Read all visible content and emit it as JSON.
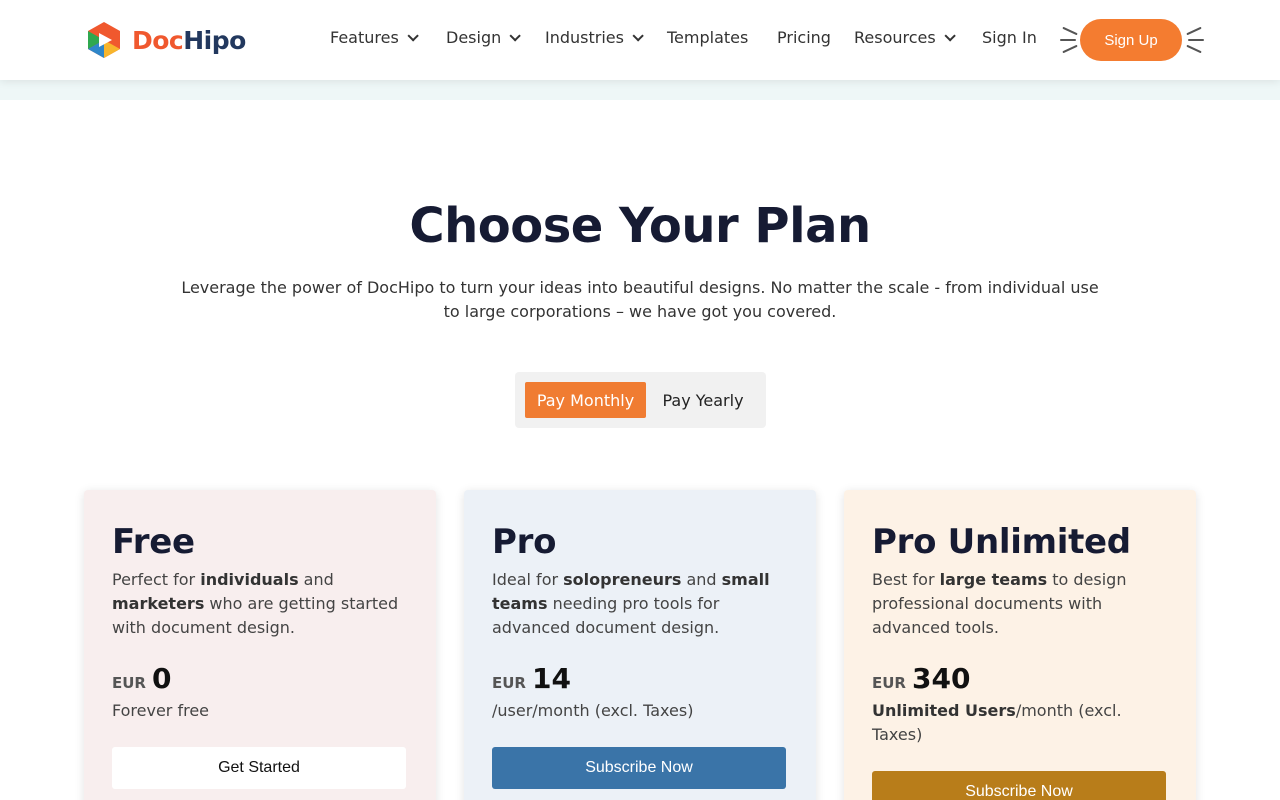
{
  "brand": {
    "name_part1": "Doc",
    "name_part2": "Hipo",
    "logo_icon": "dochipo-play-icon"
  },
  "nav": {
    "items": [
      {
        "label": "Features",
        "has_dropdown": true
      },
      {
        "label": "Design",
        "has_dropdown": true
      },
      {
        "label": "Industries",
        "has_dropdown": true
      },
      {
        "label": "Templates",
        "has_dropdown": false
      },
      {
        "label": "Pricing",
        "has_dropdown": false
      },
      {
        "label": "Resources",
        "has_dropdown": true
      },
      {
        "label": "Sign In",
        "has_dropdown": false
      }
    ],
    "signup_label": "Sign Up"
  },
  "hero": {
    "title": "Choose Your Plan",
    "subtitle": "Leverage the power of DocHipo to turn your ideas into beautiful designs. No matter the scale - from individual use to large corporations – we have got you covered."
  },
  "billing_toggle": {
    "monthly_label": "Pay Monthly",
    "yearly_label": "Pay Yearly",
    "selected": "monthly"
  },
  "plans": [
    {
      "name": "Free",
      "desc_parts": [
        "Perfect for ",
        "individuals",
        " and ",
        "marketers",
        " who are getting started with document design."
      ],
      "currency": "EUR",
      "amount": "0",
      "note_bold": "",
      "note": "Forever free",
      "cta": "Get Started"
    },
    {
      "name": "Pro",
      "desc_parts": [
        "Ideal for ",
        "solopreneurs",
        " and ",
        "small teams",
        " needing pro tools for advanced document design."
      ],
      "currency": "EUR",
      "amount": "14",
      "note_bold": "",
      "note": "/user/month (excl. Taxes)",
      "cta": "Subscribe Now"
    },
    {
      "name": "Pro Unlimited",
      "desc_parts": [
        "Best for ",
        "large teams",
        " to design professional documents with advanced tools.",
        "",
        ""
      ],
      "currency": "EUR",
      "amount": "340",
      "note_bold": "Unlimited Users",
      "note": "/month (excl. Taxes)",
      "cta": "Subscribe Now"
    }
  ],
  "colors": {
    "accent_orange": "#f47c30",
    "pro_blue": "#3a74a8",
    "unlimited_gold": "#b87d1a",
    "title_navy": "#161b33"
  }
}
